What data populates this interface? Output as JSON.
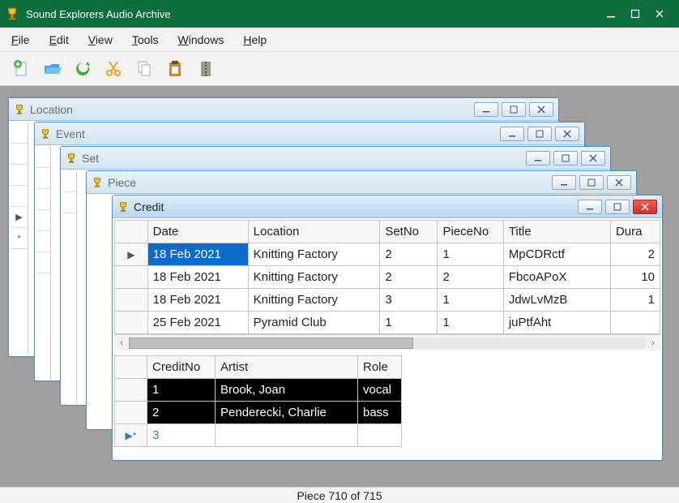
{
  "app": {
    "title": "Sound Explorers Audio Archive"
  },
  "menu": {
    "file": "File",
    "edit": "Edit",
    "view": "View",
    "tools": "Tools",
    "windows": "Windows",
    "help": "Help"
  },
  "mdi": {
    "location": "Location",
    "event": "Event",
    "set": "Set",
    "piece": "Piece",
    "credit": "Credit"
  },
  "upper_grid": {
    "columns": {
      "date": "Date",
      "location": "Location",
      "setno": "SetNo",
      "pieceno": "PieceNo",
      "title": "Title",
      "duration": "Dura"
    },
    "rows": [
      {
        "date": "18 Feb 2021",
        "location": "Knitting Factory",
        "setno": "2",
        "pieceno": "1",
        "title": "MpCDRctf",
        "dur": "2"
      },
      {
        "date": "18 Feb 2021",
        "location": "Knitting Factory",
        "setno": "2",
        "pieceno": "2",
        "title": "FbcoAPoX",
        "dur": "10"
      },
      {
        "date": "18 Feb 2021",
        "location": "Knitting Factory",
        "setno": "3",
        "pieceno": "1",
        "title": "JdwLvMzB",
        "dur": "1"
      },
      {
        "date": "25 Feb 2021",
        "location": "Pyramid Club",
        "setno": "1",
        "pieceno": "1",
        "title": "juPtfAht",
        "dur": ""
      }
    ]
  },
  "lower_grid": {
    "columns": {
      "creditno": "CreditNo",
      "artist": "Artist",
      "role": "Role"
    },
    "rows": [
      {
        "creditno": "1",
        "artist": "Brook, Joan",
        "role": "vocal"
      },
      {
        "creditno": "2",
        "artist": "Penderecki, Charlie",
        "role": "bass"
      }
    ],
    "newrow_creditno": "3"
  },
  "status": "Piece 710 of 715"
}
